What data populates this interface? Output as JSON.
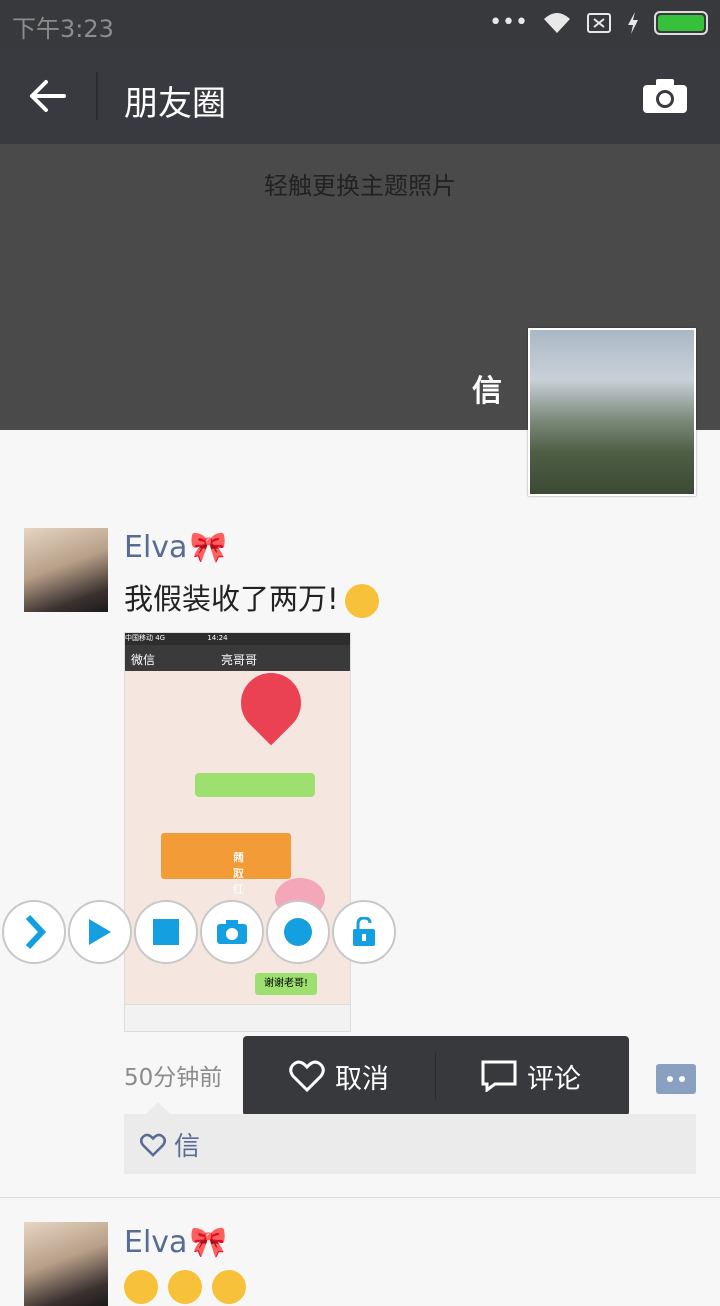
{
  "statusbar": {
    "time": "下午3:23"
  },
  "navbar": {
    "title": "朋友圈"
  },
  "cover": {
    "hint": "轻触更换主题照片",
    "owner_name": "信"
  },
  "posts": [
    {
      "author": "Elva",
      "text": "我假装收了两万!",
      "time": "50分钟前"
    },
    {
      "author": "Elva"
    }
  ],
  "screenshot": {
    "carrier": "中国移动 4G",
    "clock": "14:24",
    "back": "微信",
    "chat_title": "亮哥哥",
    "packet_title": "两万",
    "packet_sub": "领取红包",
    "thanks": "谢谢老哥!"
  },
  "actions": {
    "like": "取消",
    "comment": "评论"
  },
  "likes": {
    "names": "信"
  },
  "colors": {
    "nav": "#393a3f",
    "name": "#576b95",
    "accent": "#14a0e0"
  }
}
